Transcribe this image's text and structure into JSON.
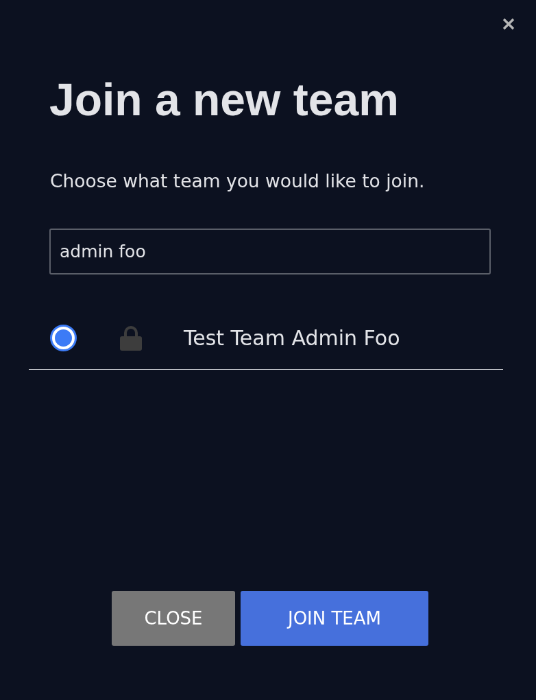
{
  "dialog": {
    "title": "Join a new team",
    "subtitle": "Choose what team you would like to join.",
    "search": {
      "value": "admin foo"
    },
    "teams": [
      {
        "name": "Test Team Admin Foo",
        "selected": true,
        "locked": true
      }
    ],
    "buttons": [
      {
        "label": "CLOSE",
        "kind": "secondary"
      },
      {
        "label": "JOIN TEAM",
        "kind": "primary"
      }
    ]
  }
}
